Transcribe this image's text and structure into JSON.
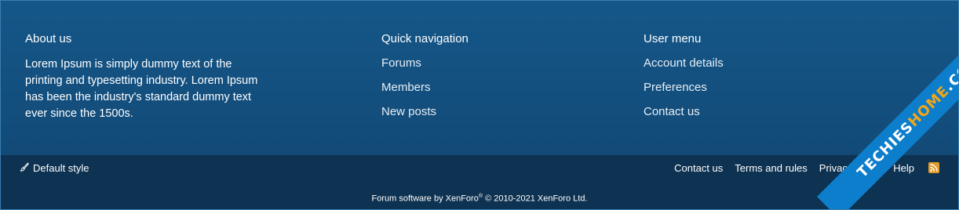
{
  "about": {
    "title": "About us",
    "text": "Lorem Ipsum is simply dummy text of the printing and typesetting industry. Lorem Ipsum has been the industry's standard dummy text ever since the 1500s."
  },
  "quick_nav": {
    "title": "Quick navigation",
    "items": [
      "Forums",
      "Members",
      "New posts"
    ]
  },
  "user_menu": {
    "title": "User menu",
    "items": [
      "Account details",
      "Preferences",
      "Contact us"
    ]
  },
  "bottom_bar": {
    "style_label": "Default style",
    "links": [
      "Contact us",
      "Terms and rules",
      "Privacy policy",
      "Help"
    ],
    "rss_icon": "rss-icon"
  },
  "copyright": {
    "prefix": "Forum software by XenForo",
    "registered": "®",
    "suffix": " © 2010-2021 XenForo Ltd."
  },
  "watermark": {
    "part1": "TECHIES",
    "part2": "HOME",
    "part3": ".COM"
  },
  "colors": {
    "upper_bg": "#155789",
    "lower_bg": "#0e3251",
    "rss": "#e39b2a",
    "watermark_band": "#0d7ecb",
    "watermark_accent": "#f4a516"
  }
}
